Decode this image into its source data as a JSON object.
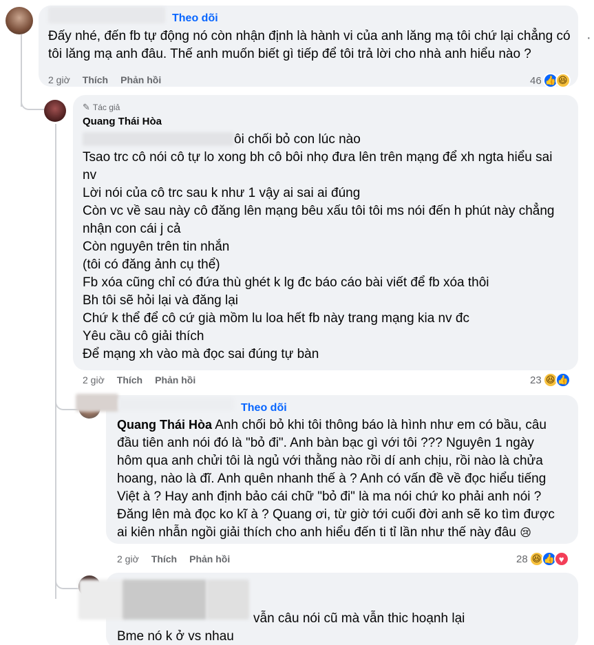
{
  "comment1": {
    "follow_label": "Theo dõi",
    "text": "Đấy nhé, đến fb tự động nó còn nhận định là hành vi của anh lăng mạ tôi chứ lại chẳng có tôi lăng mạ anh đâu. Thế anh muốn biết gì tiếp để tôi trả lời cho nhà anh hiểu nào ?",
    "time": "2 giờ",
    "like_label": "Thích",
    "reply_label": "Phản hồi",
    "reaction_count": "46",
    "more_label": "·"
  },
  "comment2": {
    "author_badge": "Tác giả",
    "author_name": "Quang Thái Hòa",
    "lines": [
      "ôi chối bỏ con lúc nào",
      "Tsao trc cô nói cô tự lo xong bh cô bôi nhọ đưa lên trên mạng để xh ngta hiểu sai",
      "nv",
      "Lời nói của cô trc sau k như 1 vậy ai sai ai đúng",
      "Còn vc về sau này cô đăng lên mạng bêu xấu tôi tôi ms nói đến h phút này chẳng",
      "nhận con cái j cả",
      "Còn nguyên trên tin nhắn",
      "(tôi có đăng ảnh cụ thể)",
      "Fb xóa cũng chỉ có đứa thù ghét k lg đc báo cáo bài viết để fb xóa thôi",
      "Bh tôi sẽ hỏi lại và đăng lại",
      "Chứ k thể để cô cứ già mồm lu loa hết fb này trang mạng kia nv đc",
      "Yêu cầu cô giải thích",
      "Để mạng xh vào mà đọc sai đúng tự bàn"
    ],
    "time": "2 giờ",
    "like_label": "Thích",
    "reply_label": "Phản hồi",
    "reaction_count": "23"
  },
  "comment3": {
    "follow_label": "Theo dõi",
    "mention": "Quang Thái Hòa",
    "lines": [
      "Anh chối bỏ khi tôi thông báo là hình như em có bầu, câu",
      "đầu tiên anh nói đó là \"bỏ đi\". Anh bàn bạc gì với tôi ??? Nguyên 1 ngày",
      "hôm qua anh chửi tôi là ngủ với thằng nào rồi dí anh chịu, rồi nào là chửa",
      "hoang, nào là đĩ. Anh quên nhanh thế à ? Anh có vấn đề về đọc hiểu tiếng",
      "Việt à ? Hay anh định bảo cái chữ \"bỏ đi\" là ma nói chứ ko phải anh nói ?",
      "Đăng lên mà đọc ko kĩ à ? Quang ơi, từ giờ tới cuối đời anh sẽ ko tìm được",
      "ai kiên nhẫn ngồi giải thích cho anh hiểu đến ti tỉ lần như thế này đâu"
    ],
    "time": "2 giờ",
    "like_label": "Thích",
    "reply_label": "Phản hồi",
    "reaction_count": "28"
  },
  "comment4": {
    "lines": [
      "vẫn câu nói cũ mà vẫn thic hoạnh lại",
      "Bme nó k ở vs nhau"
    ]
  }
}
